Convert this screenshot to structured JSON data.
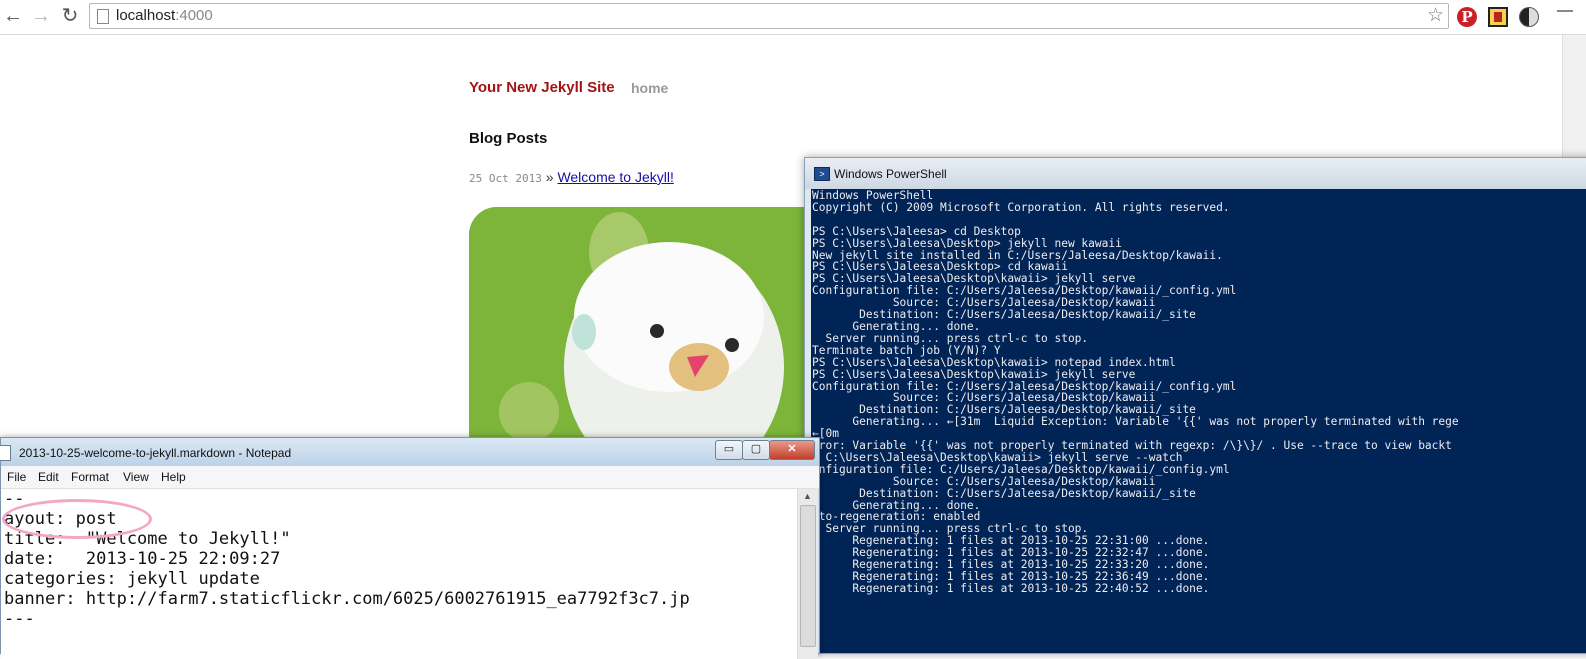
{
  "browser": {
    "url_host": "localhost",
    "url_port": ":4000"
  },
  "site": {
    "title": "Your New Jekyll Site",
    "nav_home": "home",
    "blog_heading": "Blog Posts",
    "posts": [
      {
        "date": "25 Oct 2013",
        "separator": "»",
        "title": "Welcome to Jekyll!"
      }
    ]
  },
  "powershell": {
    "title": "Windows PowerShell",
    "lines": [
      "Windows PowerShell",
      "Copyright (C) 2009 Microsoft Corporation. All rights reserved.",
      "",
      "PS C:\\Users\\Jaleesa> cd Desktop",
      "PS C:\\Users\\Jaleesa\\Desktop> jekyll new kawaii",
      "New jekyll site installed in C:/Users/Jaleesa/Desktop/kawaii.",
      "PS C:\\Users\\Jaleesa\\Desktop> cd kawaii",
      "PS C:\\Users\\Jaleesa\\Desktop\\kawaii> jekyll serve",
      "Configuration file: C:/Users/Jaleesa/Desktop/kawaii/_config.yml",
      "            Source: C:/Users/Jaleesa/Desktop/kawaii",
      "       Destination: C:/Users/Jaleesa/Desktop/kawaii/_site",
      "      Generating... done.",
      "  Server running... press ctrl-c to stop.",
      "Terminate batch job (Y/N)? Y",
      "PS C:\\Users\\Jaleesa\\Desktop\\kawaii> notepad index.html",
      "PS C:\\Users\\Jaleesa\\Desktop\\kawaii> jekyll serve",
      "Configuration file: C:/Users/Jaleesa/Desktop/kawaii/_config.yml",
      "            Source: C:/Users/Jaleesa/Desktop/kawaii",
      "       Destination: C:/Users/Jaleesa/Desktop/kawaii/_site",
      "      Generating... ←[31m  Liquid Exception: Variable '{{' was not properly terminated with rege",
      "←[0m",
      "rror: Variable '{{' was not properly terminated with regexp: /\\}\\}/ . Use --trace to view backt",
      "S C:\\Users\\Jaleesa\\Desktop\\kawaii> jekyll serve --watch",
      "onfiguration file: C:/Users/Jaleesa/Desktop/kawaii/_config.yml",
      "            Source: C:/Users/Jaleesa/Desktop/kawaii",
      "       Destination: C:/Users/Jaleesa/Desktop/kawaii/_site",
      "      Generating... done.",
      "uto-regeneration: enabled",
      "  Server running... press ctrl-c to stop.",
      "      Regenerating: 1 files at 2013-10-25 22:31:00 ...done.",
      "      Regenerating: 1 files at 2013-10-25 22:32:47 ...done.",
      "      Regenerating: 1 files at 2013-10-25 22:33:20 ...done.",
      "      Regenerating: 1 files at 2013-10-25 22:36:49 ...done.",
      "      Regenerating: 1 files at 2013-10-25 22:40:52 ...done."
    ]
  },
  "notepad": {
    "title": "2013-10-25-welcome-to-jekyll.markdown - Notepad",
    "menu": [
      "File",
      "Edit",
      "Format",
      "View",
      "Help"
    ],
    "buttons": {
      "minimize": "▭",
      "maximize": "▢",
      "close": "✕"
    },
    "lines": [
      "--",
      "ayout: post",
      "title:  \"Welcome to Jekyll!\"",
      "date:   2013-10-25 22:09:27",
      "categories: jekyll update",
      "banner: http://farm7.staticflickr.com/6025/6002761915_ea7792f3c7.jp",
      "---"
    ]
  },
  "colors": {
    "site_title": "#a31515",
    "link": "#1a0dab",
    "ps_background": "#012456",
    "highlight": "#f4a6c6"
  }
}
